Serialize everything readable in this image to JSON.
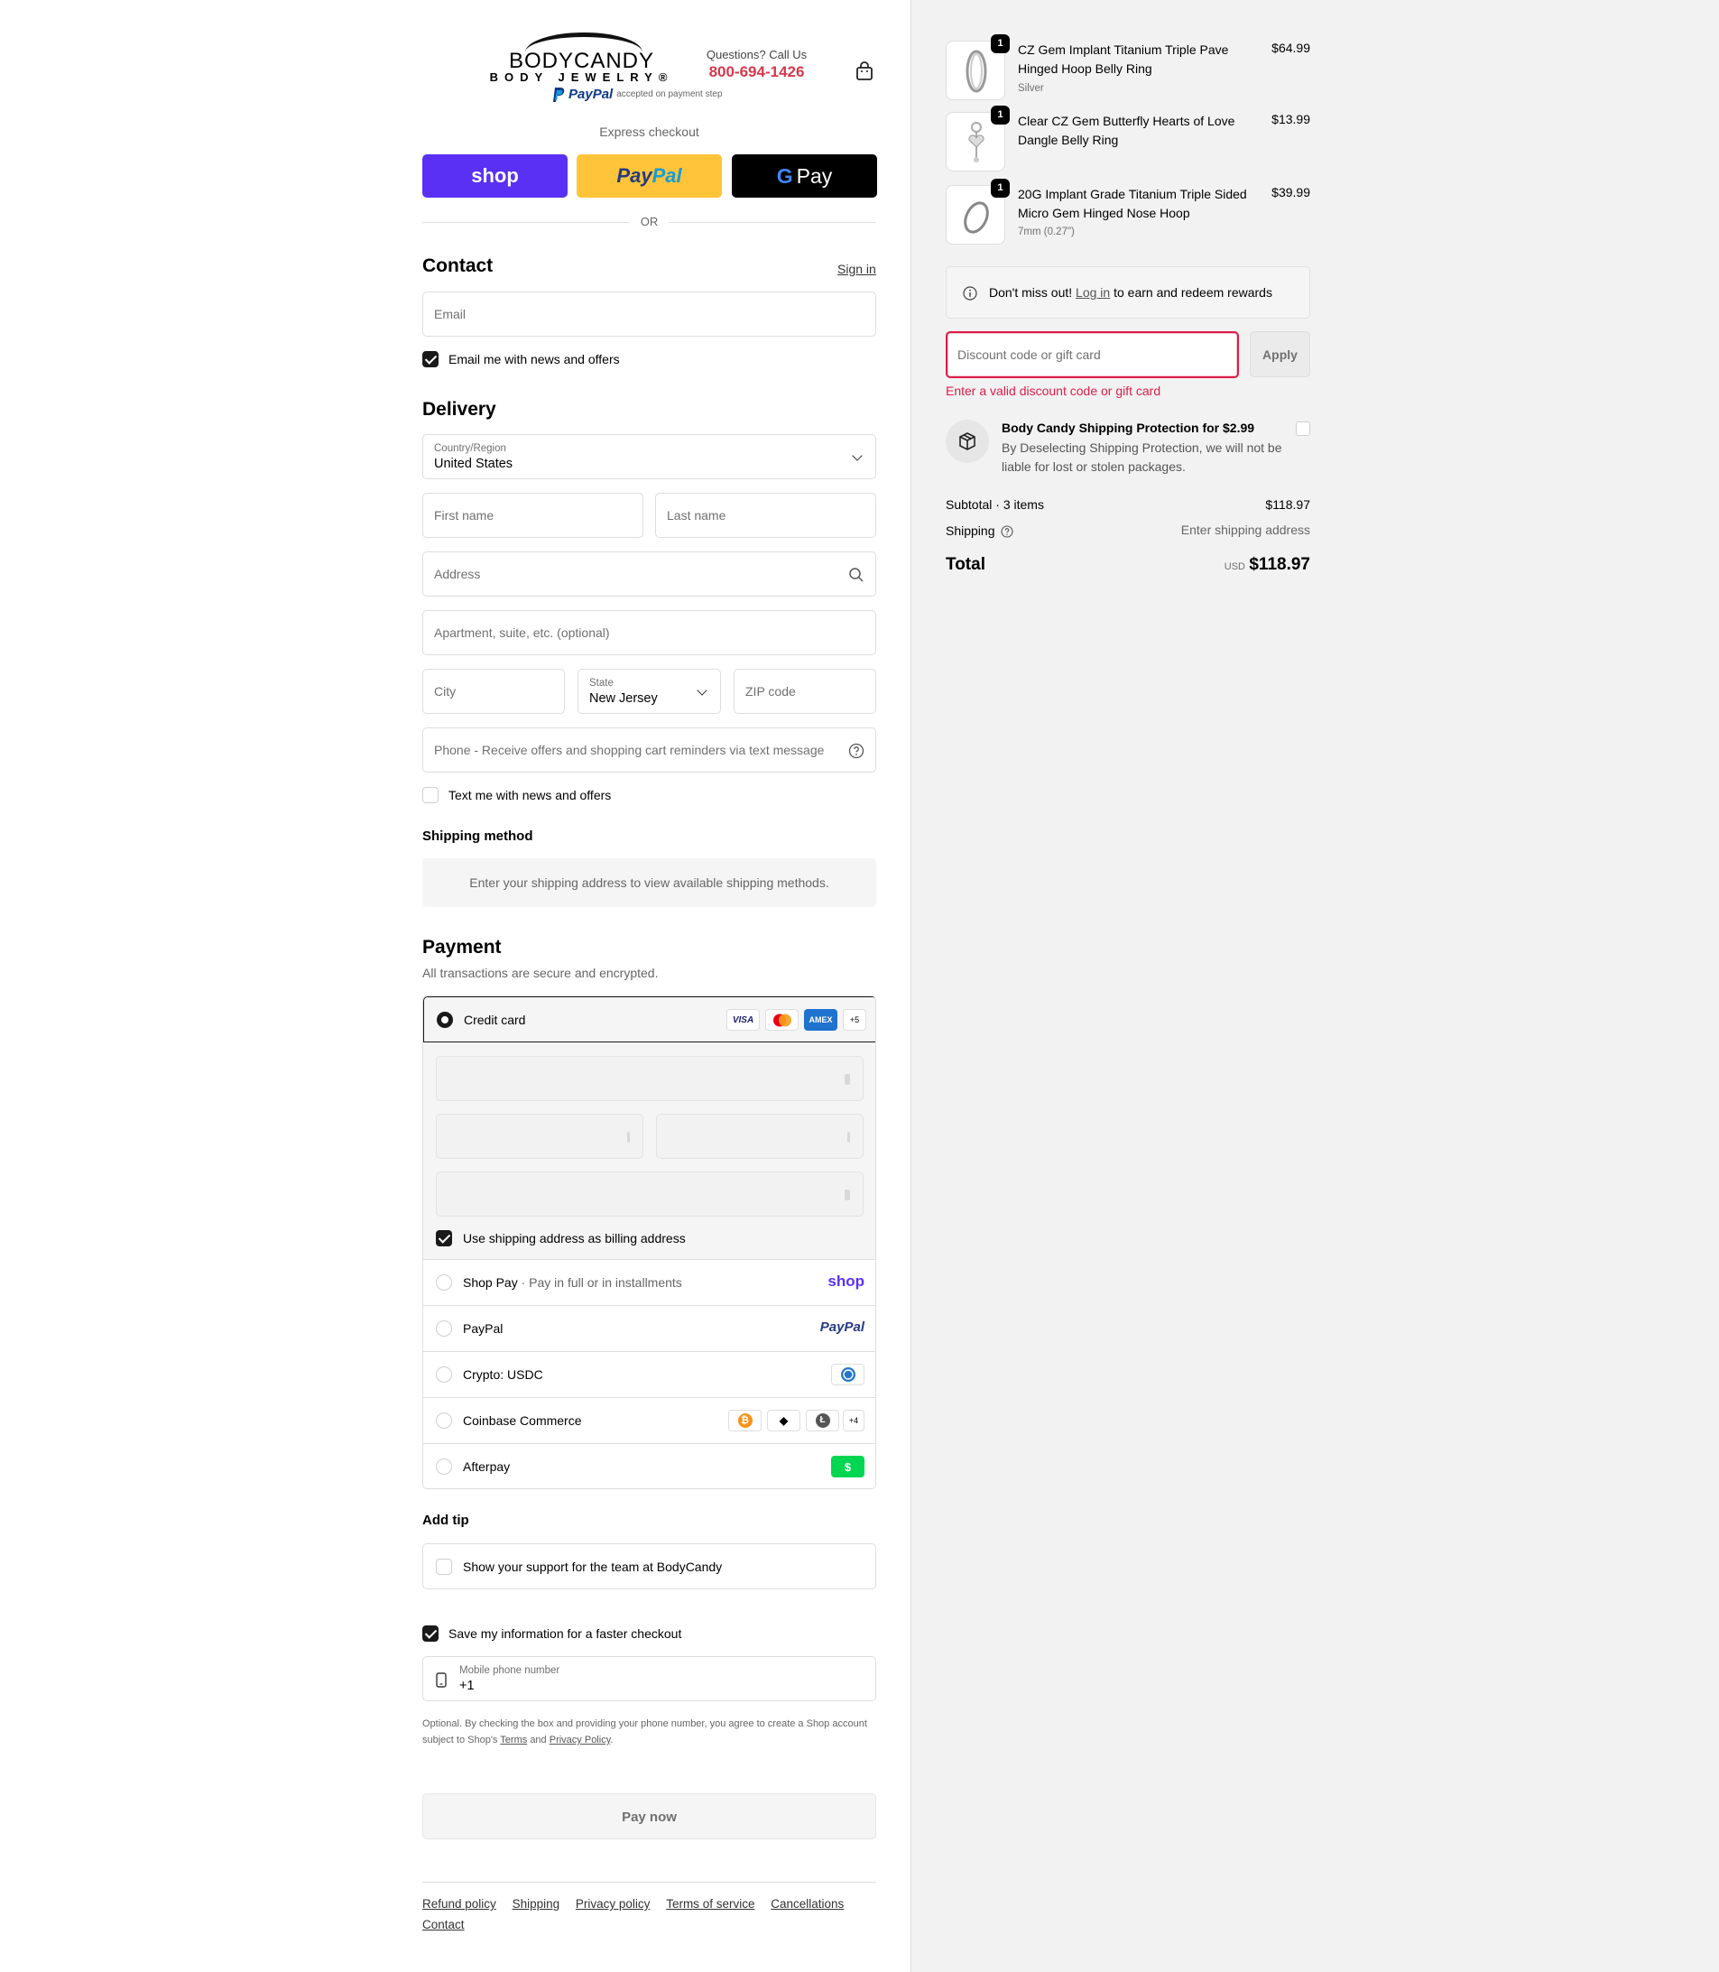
{
  "header": {
    "brand_name": "BODYCANDY",
    "brand_sub": "BODY JEWELRY®",
    "questions": "Questions? Call Us",
    "phone": "800-694-1426",
    "paypal_logo": "PayPal",
    "paypal_note": "accepted on payment step",
    "bag_icon": "shopping-bag-icon"
  },
  "express": {
    "label": "Express checkout",
    "shop_label": "shop",
    "paypal_pay": "Pay",
    "paypal_pal": "Pal",
    "gpay_g": "G",
    "gpay_label": "Pay",
    "or": "OR"
  },
  "contact": {
    "title": "Contact",
    "sign_in": "Sign in",
    "email_placeholder": "Email",
    "email_news": "Email me with news and offers",
    "email_news_checked": true
  },
  "delivery": {
    "title": "Delivery",
    "country_label": "Country/Region",
    "country_value": "United States",
    "first_name": "First name",
    "last_name": "Last name",
    "address": "Address",
    "apartment": "Apartment, suite, etc. (optional)",
    "city": "City",
    "state_label": "State",
    "state_value": "New Jersey",
    "zip": "ZIP code",
    "phone": "Phone - Receive offers and shopping cart reminders via text message",
    "text_news": "Text me with news and offers",
    "text_news_checked": false
  },
  "shipping_method": {
    "title": "Shipping method",
    "message": "Enter your shipping address to view available shipping methods."
  },
  "payment": {
    "title": "Payment",
    "subtitle": "All transactions are secure and encrypted.",
    "credit_card": "Credit card",
    "card_brands": [
      "VISA",
      "",
      "AMEX",
      "+5"
    ],
    "billing_same": "Use shipping address as billing address",
    "billing_same_checked": true,
    "methods": [
      {
        "name": "Shop Pay",
        "sep": "·",
        "note": "Pay in full or in installments",
        "badge": "shop"
      },
      {
        "name": "PayPal",
        "badge": "PayPal"
      },
      {
        "name": "Crypto: USDC",
        "badge": "usdc-icon"
      },
      {
        "name": "Coinbase Commerce",
        "badge": "+4"
      },
      {
        "name": "Afterpay",
        "badge": "$"
      }
    ],
    "coinbase_coins": [
      "₿",
      "◆",
      "Ł"
    ]
  },
  "tip": {
    "title": "Add tip",
    "label": "Show your support for the team at BodyCandy"
  },
  "save": {
    "label": "Save my information for a faster checkout",
    "checked": true,
    "mobile_label": "Mobile phone number",
    "mobile_value": "+1",
    "legal_prefix": "Optional. By checking the box and providing your phone number, you agree to create a Shop account subject to Shop's",
    "terms": "Terms",
    "and": "and",
    "privacy": "Privacy Policy"
  },
  "pay_now": "Pay now",
  "footer": {
    "links": [
      "Refund policy",
      "Shipping",
      "Privacy policy",
      "Terms of service",
      "Cancellations",
      "Contact"
    ]
  },
  "cart": {
    "items": [
      {
        "name": "CZ Gem Implant Titanium Triple Pave Hinged Hoop Belly Ring",
        "variant": "Silver",
        "price": "$64.99",
        "qty": "1"
      },
      {
        "name": "Clear CZ Gem Butterfly Hearts of Love Dangle Belly Ring",
        "variant": "",
        "price": "$13.99",
        "qty": "1"
      },
      {
        "name": "20G Implant Grade Titanium Triple Sided Micro Gem Hinged Nose Hoop",
        "variant": "7mm (0.27\")",
        "price": "$39.99",
        "qty": "1"
      }
    ],
    "rewards_prefix": "Don't miss out!",
    "rewards_link": "Log in",
    "rewards_suffix": "to earn and redeem rewards",
    "discount_placeholder": "Discount code or gift card",
    "apply": "Apply",
    "discount_error": "Enter a valid discount code or gift card",
    "protection_title": "Body Candy Shipping Protection for $2.99",
    "protection_desc": "By Deselecting Shipping Protection, we will not be liable for lost or stolen packages.",
    "subtotal_label": "Subtotal · 3 items",
    "subtotal_value": "$118.97",
    "shipping_label": "Shipping",
    "shipping_value": "Enter shipping address",
    "total_label": "Total",
    "total_currency": "USD",
    "total_value": "$118.97"
  },
  "colors": {
    "shop_purple": "#5a31f4",
    "paypal_yellow": "#ffc439",
    "error_red": "#dd1d4a",
    "phone_red": "#d4394c"
  }
}
